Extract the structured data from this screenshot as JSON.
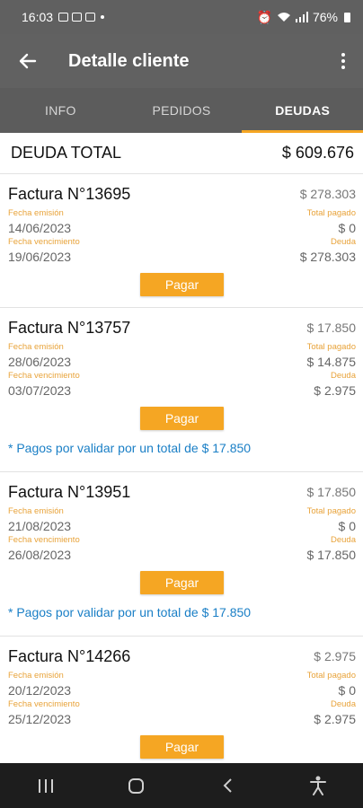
{
  "status_bar": {
    "time": "16:03",
    "battery": "76%"
  },
  "app_bar": {
    "title": "Detalle cliente"
  },
  "tabs": [
    {
      "label": "INFO",
      "active": false
    },
    {
      "label": "PEDIDOS",
      "active": false
    },
    {
      "label": "DEUDAS",
      "active": true
    }
  ],
  "summary": {
    "label": "DEUDA TOTAL",
    "value": "$ 609.676"
  },
  "labels": {
    "issue_date": "Fecha emisión",
    "due_date": "Fecha vencimiento",
    "total_paid": "Total pagado",
    "debt": "Deuda",
    "pay_button": "Pagar"
  },
  "invoices": [
    {
      "title": "Factura N°13695",
      "amount": "$ 278.303",
      "issue_date": "14/06/2023",
      "due_date": "19/06/2023",
      "total_paid": "$ 0",
      "debt": "$ 278.303",
      "note": ""
    },
    {
      "title": "Factura N°13757",
      "amount": "$ 17.850",
      "issue_date": "28/06/2023",
      "due_date": "03/07/2023",
      "total_paid": "$ 14.875",
      "debt": "$ 2.975",
      "note": "* Pagos por validar por un total de $ 17.850"
    },
    {
      "title": "Factura N°13951",
      "amount": "$ 17.850",
      "issue_date": "21/08/2023",
      "due_date": "26/08/2023",
      "total_paid": "$ 0",
      "debt": "$ 17.850",
      "note": "* Pagos por validar por un total de $ 17.850"
    },
    {
      "title": "Factura N°14266",
      "amount": "$ 2.975",
      "issue_date": "20/12/2023",
      "due_date": "25/12/2023",
      "total_paid": "$ 0",
      "debt": "$ 2.975",
      "note": ""
    }
  ],
  "icons": {
    "back": "arrow-left-icon",
    "more": "more-vert-icon",
    "nav_recents": "recents-icon",
    "nav_home": "home-icon",
    "nav_back": "chevron-left-icon",
    "nav_accessibility": "accessibility-icon"
  },
  "colors": {
    "accent": "#f5a623",
    "toolbar": "#616161",
    "note": "#1a7fc6"
  }
}
